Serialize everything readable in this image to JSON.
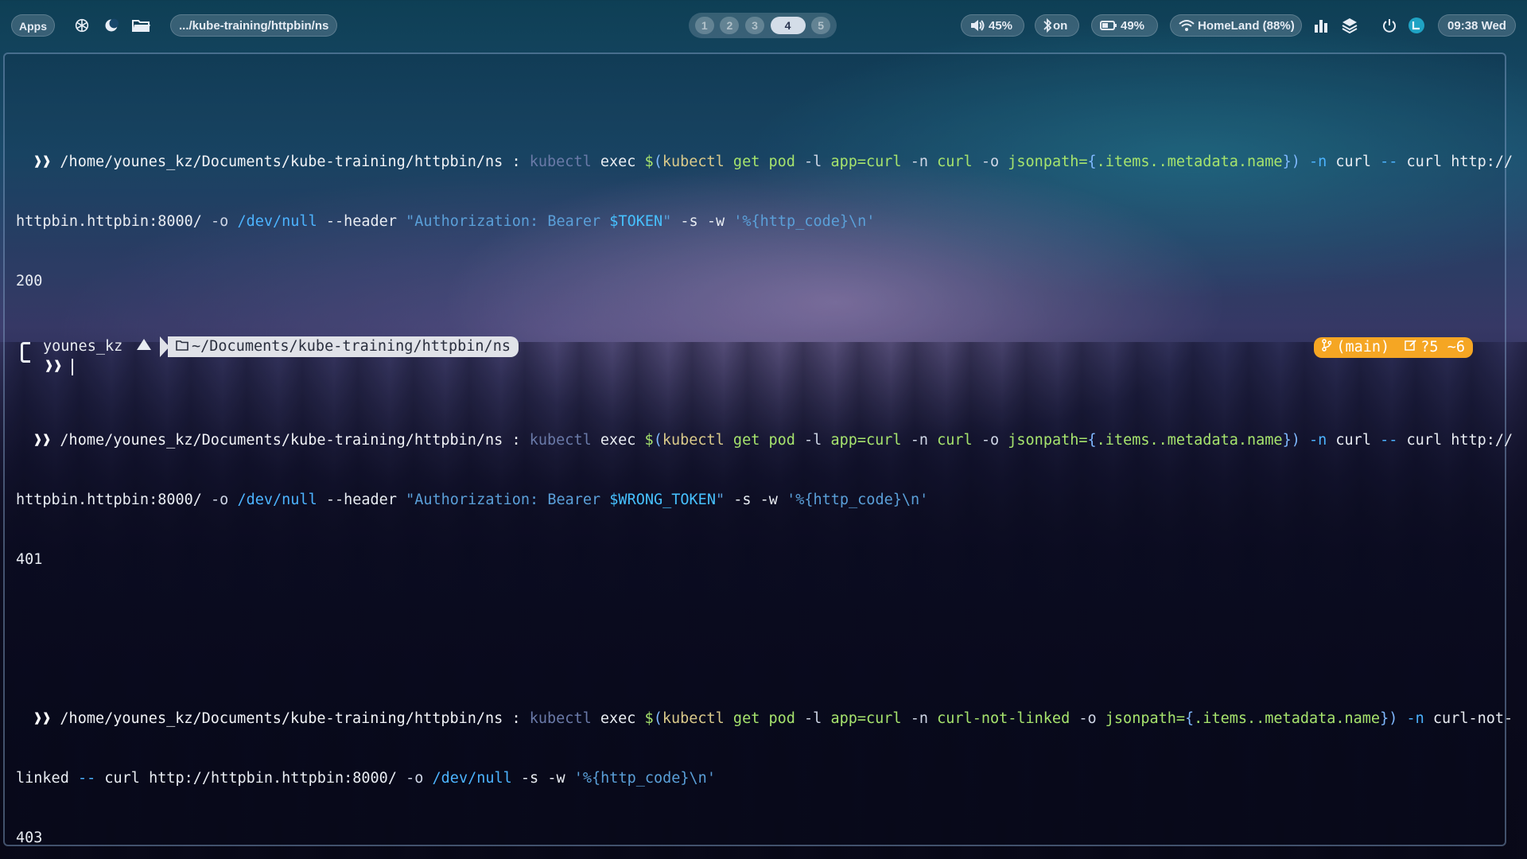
{
  "topbar": {
    "apps_label": "Apps",
    "path_label": ".../kube-training/httpbin/ns",
    "workspaces": [
      "1",
      "2",
      "3",
      "4",
      "5"
    ],
    "active_workspace": "4",
    "volume": "45%",
    "bluetooth": "on",
    "battery": "49%",
    "wifi": "HomeLand (88%)",
    "clock": "09:38 Wed",
    "icons": [
      "openai-icon",
      "moon-icon",
      "folder-icon",
      "speaker-icon",
      "bluetooth-icon",
      "battery-icon",
      "wifi-icon",
      "bar-chart-icon",
      "layers-icon",
      "power-icon",
      "avatar-icon"
    ]
  },
  "terminal": {
    "prompt_symbol": "❱❱",
    "cwd_full": "/home/younes_kz/Documents/kube-training/httpbin/ns",
    "sep": ":",
    "cmd1": {
      "line1": {
        "kubectl": "kubectl",
        "exec": " exec ",
        "dollar": "$",
        "open": "(",
        "sub": "kubectl",
        "getpod": " get pod ",
        "l": "-l ",
        "app": "app=curl",
        "n": " -n ",
        "ns": "curl",
        "o": " -o ",
        "jp": "jsonpath=",
        "brace_open": "{",
        "items": ".items..metadata.name",
        "brace_close": "}",
        "close": ")",
        "n2": " -n ",
        "ns2": "curl",
        "dd": " -- ",
        "curl": "curl ",
        "url": "http://"
      },
      "line2": {
        "host": "httpbin.httpbin:8000/",
        "o": " -o ",
        "devnull": "/dev/null",
        "header": " --header ",
        "str": "\"Authorization: Bearer ",
        "var": "$TOKEN",
        "strend": "\"",
        "s": " -s -w ",
        "fmt": "'%{http_code}\\n'"
      },
      "output": "200"
    },
    "cmd2": {
      "line1": {
        "kubectl": "kubectl",
        "exec": " exec ",
        "dollar": "$",
        "open": "(",
        "sub": "kubectl",
        "getpod": " get pod ",
        "l": "-l ",
        "app": "app=curl",
        "n": " -n ",
        "ns": "curl",
        "o": " -o ",
        "jp": "jsonpath=",
        "brace_open": "{",
        "items": ".items..metadata.name",
        "brace_close": "}",
        "close": ")",
        "n2": " -n ",
        "ns2": "curl",
        "dd": " -- ",
        "curl": "curl ",
        "url": "http://"
      },
      "line2": {
        "host": "httpbin.httpbin:8000/",
        "o": " -o ",
        "devnull": "/dev/null",
        "header": " --header ",
        "str": "\"Authorization: Bearer ",
        "var": "$WRONG_TOKEN",
        "strend": "\"",
        "s": " -s -w ",
        "fmt": "'%{http_code}\\n'"
      },
      "output": "401"
    },
    "cmd3": {
      "line1": {
        "kubectl": "kubectl",
        "exec": " exec ",
        "dollar": "$",
        "open": "(",
        "sub": "kubectl",
        "getpod": " get pod ",
        "l": "-l ",
        "app": "app=curl",
        "n": " -n ",
        "ns": "curl-not-linked",
        "o": " -o ",
        "jp": "jsonpath=",
        "brace_open": "{",
        "items": ".items..metadata.name",
        "brace_close": "}",
        "close": ")",
        "n2": " -n ",
        "ns2": "curl-not-"
      },
      "line2": {
        "cont": "linked",
        "dd": " -- ",
        "curl": "curl ",
        "url": "http://httpbin.httpbin:8000/",
        "o": " -o ",
        "devnull": "/dev/null",
        "s": " -s -w ",
        "fmt": "'%{http_code}\\n'"
      },
      "output": "403"
    },
    "powerline": {
      "user": "younes_kz",
      "dir": "~/Documents/kube-training/httpbin/ns",
      "git": "(main)",
      "git_status": "?5 ~6"
    }
  }
}
